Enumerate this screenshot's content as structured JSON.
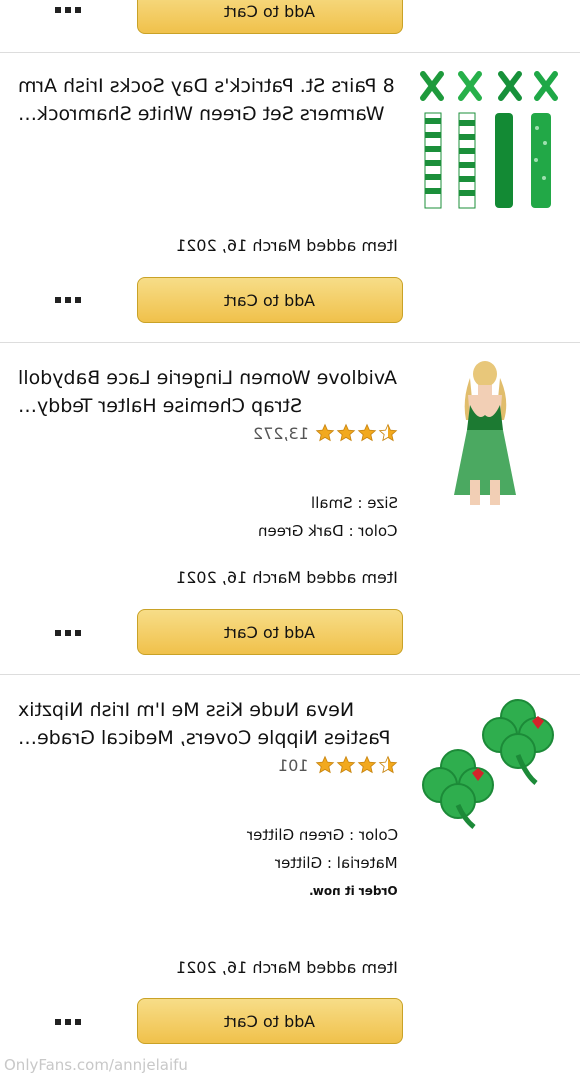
{
  "top": {
    "cart_label": "Add to Cart"
  },
  "items": [
    {
      "title": "8 Pairs St. Patrick's Day Socks Irish Arm Warmers Set Green White Shamrock…",
      "added": "Item added March 16, 2021",
      "cart_label": "Add to Cart",
      "image_icon": "socks-and-arm-warmers-image"
    },
    {
      "title": "Avidlove Women Lingerie Lace Babydoll Strap Chemise Halter Teddy…",
      "rating_stars": 3.5,
      "rating_count": "13,272",
      "size": "Size : Small",
      "color": "Color : Dark Green",
      "added": "Item added March 16, 2021",
      "cart_label": "Add to Cart",
      "image_icon": "green-lingerie-image"
    },
    {
      "title": "Neva Nude Kiss Me I'm Irish Nipztix Pasties Nipple Covers, Medical Grade…",
      "rating_stars": 3.5,
      "rating_count": "101",
      "color": "Color : Green Glitter",
      "material": "Material : Glitter",
      "note": "Order it now.",
      "added": "Item added March 16, 2021",
      "cart_label": "Add to Cart",
      "image_icon": "shamrock-pasties-image"
    }
  ],
  "watermark": "OnlyFans.com/annjelaifu",
  "colors": {
    "button": "#f0c14b",
    "star": "#f2a91e"
  }
}
